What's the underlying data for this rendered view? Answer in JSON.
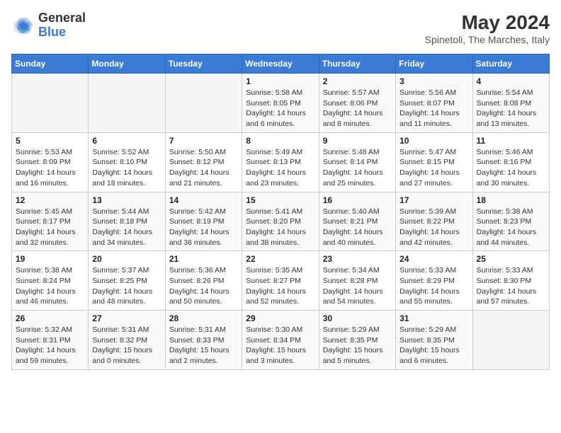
{
  "header": {
    "logo_general": "General",
    "logo_blue": "Blue",
    "month_title": "May 2024",
    "location": "Spinetoli, The Marches, Italy"
  },
  "days_of_week": [
    "Sunday",
    "Monday",
    "Tuesday",
    "Wednesday",
    "Thursday",
    "Friday",
    "Saturday"
  ],
  "weeks": [
    [
      {
        "day": "",
        "info": ""
      },
      {
        "day": "",
        "info": ""
      },
      {
        "day": "",
        "info": ""
      },
      {
        "day": "1",
        "info": "Sunrise: 5:58 AM\nSunset: 8:05 PM\nDaylight: 14 hours\nand 6 minutes."
      },
      {
        "day": "2",
        "info": "Sunrise: 5:57 AM\nSunset: 8:06 PM\nDaylight: 14 hours\nand 8 minutes."
      },
      {
        "day": "3",
        "info": "Sunrise: 5:56 AM\nSunset: 8:07 PM\nDaylight: 14 hours\nand 11 minutes."
      },
      {
        "day": "4",
        "info": "Sunrise: 5:54 AM\nSunset: 8:08 PM\nDaylight: 14 hours\nand 13 minutes."
      }
    ],
    [
      {
        "day": "5",
        "info": "Sunrise: 5:53 AM\nSunset: 8:09 PM\nDaylight: 14 hours\nand 16 minutes."
      },
      {
        "day": "6",
        "info": "Sunrise: 5:52 AM\nSunset: 8:10 PM\nDaylight: 14 hours\nand 18 minutes."
      },
      {
        "day": "7",
        "info": "Sunrise: 5:50 AM\nSunset: 8:12 PM\nDaylight: 14 hours\nand 21 minutes."
      },
      {
        "day": "8",
        "info": "Sunrise: 5:49 AM\nSunset: 8:13 PM\nDaylight: 14 hours\nand 23 minutes."
      },
      {
        "day": "9",
        "info": "Sunrise: 5:48 AM\nSunset: 8:14 PM\nDaylight: 14 hours\nand 25 minutes."
      },
      {
        "day": "10",
        "info": "Sunrise: 5:47 AM\nSunset: 8:15 PM\nDaylight: 14 hours\nand 27 minutes."
      },
      {
        "day": "11",
        "info": "Sunrise: 5:46 AM\nSunset: 8:16 PM\nDaylight: 14 hours\nand 30 minutes."
      }
    ],
    [
      {
        "day": "12",
        "info": "Sunrise: 5:45 AM\nSunset: 8:17 PM\nDaylight: 14 hours\nand 32 minutes."
      },
      {
        "day": "13",
        "info": "Sunrise: 5:44 AM\nSunset: 8:18 PM\nDaylight: 14 hours\nand 34 minutes."
      },
      {
        "day": "14",
        "info": "Sunrise: 5:42 AM\nSunset: 8:19 PM\nDaylight: 14 hours\nand 36 minutes."
      },
      {
        "day": "15",
        "info": "Sunrise: 5:41 AM\nSunset: 8:20 PM\nDaylight: 14 hours\nand 38 minutes."
      },
      {
        "day": "16",
        "info": "Sunrise: 5:40 AM\nSunset: 8:21 PM\nDaylight: 14 hours\nand 40 minutes."
      },
      {
        "day": "17",
        "info": "Sunrise: 5:39 AM\nSunset: 8:22 PM\nDaylight: 14 hours\nand 42 minutes."
      },
      {
        "day": "18",
        "info": "Sunrise: 5:38 AM\nSunset: 8:23 PM\nDaylight: 14 hours\nand 44 minutes."
      }
    ],
    [
      {
        "day": "19",
        "info": "Sunrise: 5:38 AM\nSunset: 8:24 PM\nDaylight: 14 hours\nand 46 minutes."
      },
      {
        "day": "20",
        "info": "Sunrise: 5:37 AM\nSunset: 8:25 PM\nDaylight: 14 hours\nand 48 minutes."
      },
      {
        "day": "21",
        "info": "Sunrise: 5:36 AM\nSunset: 8:26 PM\nDaylight: 14 hours\nand 50 minutes."
      },
      {
        "day": "22",
        "info": "Sunrise: 5:35 AM\nSunset: 8:27 PM\nDaylight: 14 hours\nand 52 minutes."
      },
      {
        "day": "23",
        "info": "Sunrise: 5:34 AM\nSunset: 8:28 PM\nDaylight: 14 hours\nand 54 minutes."
      },
      {
        "day": "24",
        "info": "Sunrise: 5:33 AM\nSunset: 8:29 PM\nDaylight: 14 hours\nand 55 minutes."
      },
      {
        "day": "25",
        "info": "Sunrise: 5:33 AM\nSunset: 8:30 PM\nDaylight: 14 hours\nand 57 minutes."
      }
    ],
    [
      {
        "day": "26",
        "info": "Sunrise: 5:32 AM\nSunset: 8:31 PM\nDaylight: 14 hours\nand 59 minutes."
      },
      {
        "day": "27",
        "info": "Sunrise: 5:31 AM\nSunset: 8:32 PM\nDaylight: 15 hours\nand 0 minutes."
      },
      {
        "day": "28",
        "info": "Sunrise: 5:31 AM\nSunset: 8:33 PM\nDaylight: 15 hours\nand 2 minutes."
      },
      {
        "day": "29",
        "info": "Sunrise: 5:30 AM\nSunset: 8:34 PM\nDaylight: 15 hours\nand 3 minutes."
      },
      {
        "day": "30",
        "info": "Sunrise: 5:29 AM\nSunset: 8:35 PM\nDaylight: 15 hours\nand 5 minutes."
      },
      {
        "day": "31",
        "info": "Sunrise: 5:29 AM\nSunset: 8:35 PM\nDaylight: 15 hours\nand 6 minutes."
      },
      {
        "day": "",
        "info": ""
      }
    ]
  ]
}
